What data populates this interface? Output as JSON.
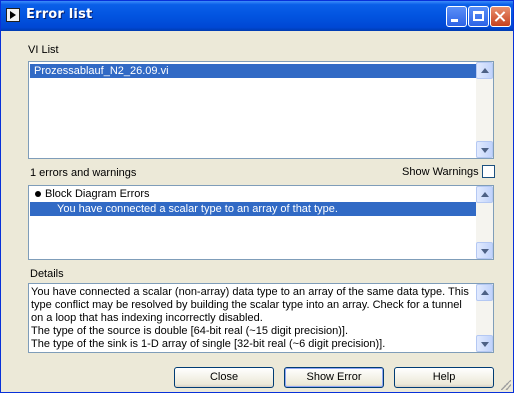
{
  "window": {
    "title": "Error list"
  },
  "vi_list": {
    "label": "VI List",
    "items": [
      {
        "label": "Prozessablauf_N2_26.09.vi",
        "selected": true
      }
    ]
  },
  "errors": {
    "summary": "1 errors and warnings",
    "show_warnings_label": "Show Warnings",
    "show_warnings_checked": false,
    "group_label": "Block Diagram Errors",
    "items": [
      {
        "label": "You have connected a scalar type to an array of that type.",
        "selected": true
      }
    ]
  },
  "details": {
    "label": "Details",
    "lines": [
      "You have connected a scalar (non-array) data type to an array of the same data type. This",
      "type conflict may be resolved by building the scalar type into an array. Check for a tunnel",
      "on a loop that has indexing incorrectly disabled.",
      "The type of the source is double [64-bit real (~15 digit precision)].",
      "The type of the sink is 1-D array of single [32-bit real (~6 digit precision)]."
    ]
  },
  "buttons": {
    "close": "Close",
    "show_error": "Show Error",
    "help": "Help"
  },
  "colors": {
    "title_bar": "#0254e0",
    "selection": "#316ac5",
    "dialog_bg": "#ece9d8"
  }
}
